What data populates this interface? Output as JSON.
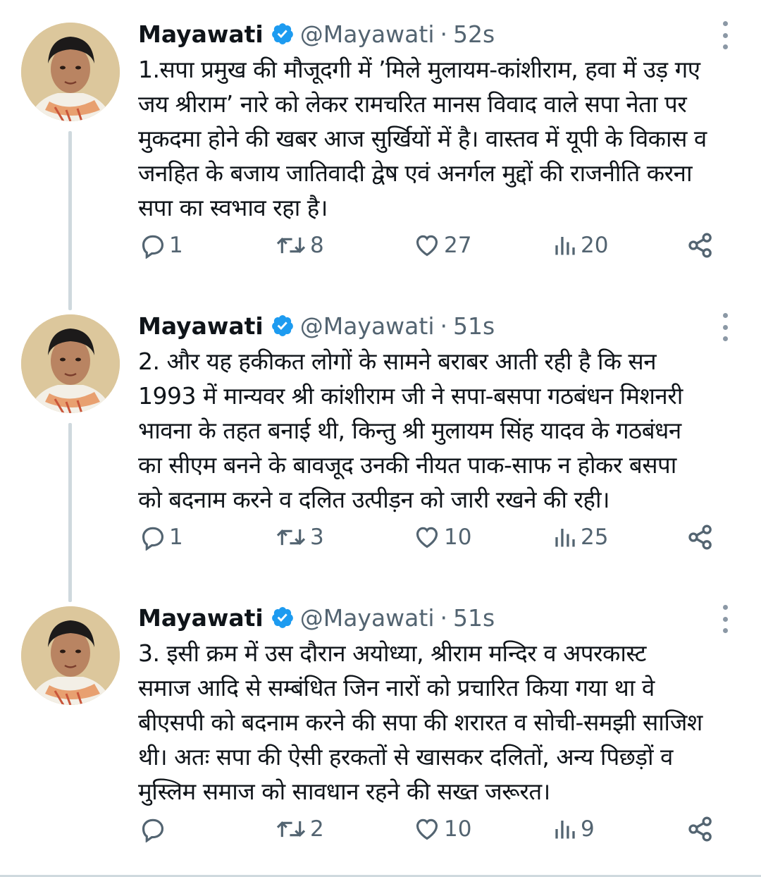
{
  "colors": {
    "icon": "#536471",
    "verified": "#1d9bf0",
    "text": "#0f1419",
    "thread_line": "#cfd9de"
  },
  "tweets": [
    {
      "author": "Mayawati",
      "handle": "@Mayawati",
      "separator": "·",
      "time": "52s",
      "text": "1.सपा प्रमुख की मौजूदगी में ’मिले मुलायम-कांशीराम, हवा में उड़ गए\nजय श्रीराम’ नारे को लेकर रामचरित मानस विवाद वाले सपा नेता पर\nमुकदमा होने की खबर आज सुर्खियों में है। वास्तव में यूपी के विकास व\nजनहित के बजाय जातिवादी द्वेष एवं अनर्गल मुद्दों की राजनीति करना\nसपा का स्वभाव रहा है।",
      "replies": "1",
      "retweets": "8",
      "likes": "27",
      "views": "20"
    },
    {
      "author": "Mayawati",
      "handle": "@Mayawati",
      "separator": "·",
      "time": "51s",
      "text": "2. और यह हकीकत लोगों के सामने बराबर आती रही है कि सन\n1993 में मान्यवर श्री कांशीराम जी ने सपा-बसपा गठबंधन मिशनरी\nभावना के तहत बनाई थी, किन्तु श्री मुलायम सिंह यादव के गठबंधन\nका सीएम बनने के बावजूद उनकी नीयत पाक-साफ न होकर बसपा\nको बदनाम करने व दलित उत्पीड़न को जारी रखने की रही।",
      "replies": "1",
      "retweets": "3",
      "likes": "10",
      "views": "25"
    },
    {
      "author": "Mayawati",
      "handle": "@Mayawati",
      "separator": "·",
      "time": "51s",
      "text": "3. इसी क्रम में उस दौरान अयोध्या, श्रीराम मन्दिर व अपरकास्ट\nसमाज आदि से सम्बंधित जिन नारों को   प्रचारित किया गया था वे\nबीएसपी को बदनाम करने की सपा की शरारत व सोची-समझी साजिश\nथी। अतः सपा की ऐसी हरकतों से खासकर दलितों, अन्य पिछड़ों व\nमुस्लिम समाज को सावधान रहने की सख्त जरूरत।",
      "replies": "",
      "retweets": "2",
      "likes": "10",
      "views": "9"
    }
  ]
}
